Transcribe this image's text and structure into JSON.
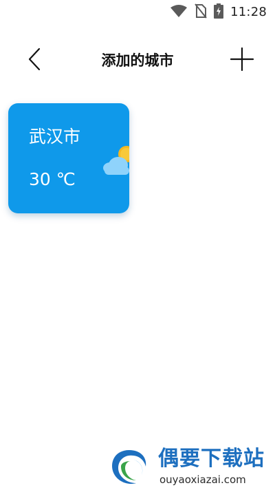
{
  "status_bar": {
    "time": "11:28",
    "icons": [
      "wifi-icon",
      "no-sim-icon",
      "battery-charging-icon"
    ]
  },
  "header": {
    "title": "添加的城市",
    "back_icon": "chevron-left-icon",
    "add_icon": "plus-icon"
  },
  "cities": [
    {
      "name": "武汉市",
      "temperature": "30 ℃",
      "weather_icon": "partly-cloudy-icon"
    }
  ],
  "colors": {
    "card_background": "#0f99ea",
    "text_on_card": "#ffffff",
    "page_background": "#ffffff",
    "watermark_brand": "#1d6fbf"
  },
  "watermark": {
    "title": "偶要下载站",
    "url": "ouyaoxiazai.com"
  }
}
